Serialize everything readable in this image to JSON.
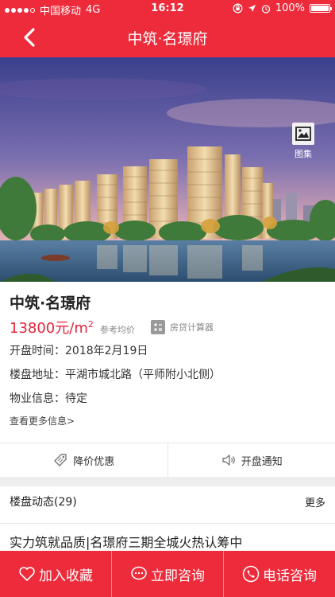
{
  "status": {
    "carrier": "中国移动",
    "network": "4G",
    "time": "16:12",
    "battery": "100%"
  },
  "header": {
    "title": "中筑·名璟府"
  },
  "hero": {
    "gallery_label": "图集"
  },
  "project": {
    "name": "中筑·名璟府",
    "price": "13800元/m",
    "price_unit_sup": "2",
    "price_note": "参考均价",
    "calculator_label": "房贷计算器",
    "open_label": "开盘时间：",
    "open_value": "2018年2月19日",
    "address_label": "楼盘地址：",
    "address_value": "平湖市城北路（平师附小北侧）",
    "property_label": "物业信息：",
    "property_value": "待定",
    "more_info": "查看更多信息>"
  },
  "actions": {
    "discount": "降价优惠",
    "notify": "开盘通知"
  },
  "dynamics": {
    "title": "楼盘动态(29)",
    "more": "更多",
    "latest": "实力筑就品质|名璟府三期全城火热认筹中"
  },
  "bottom_bar": {
    "favorite": "加入收藏",
    "consult": "立即咨询",
    "call": "电话咨询"
  },
  "colors": {
    "brand": "#ee2b3b",
    "price": "#e5233a"
  }
}
